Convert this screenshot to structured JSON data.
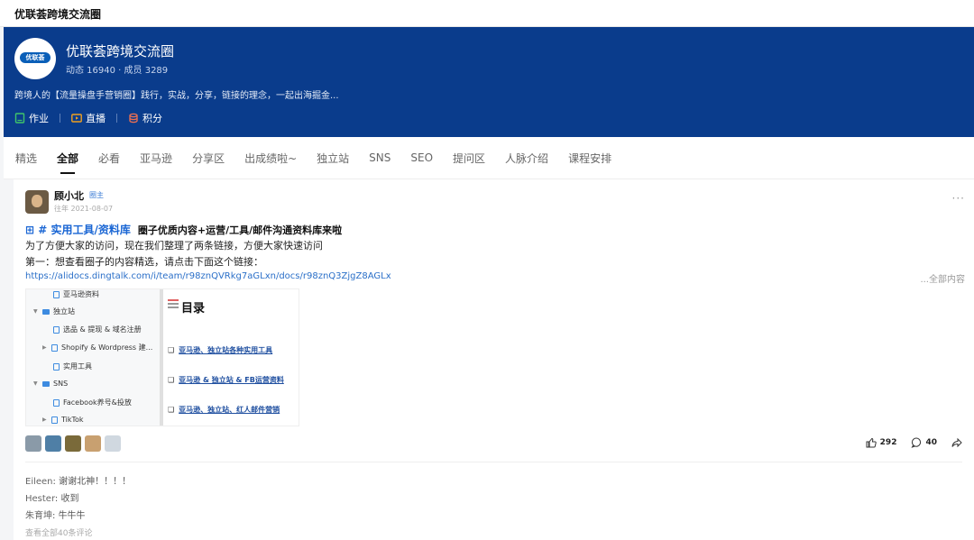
{
  "topbar": {
    "title": "优联荟跨境交流圈"
  },
  "hero": {
    "logo_text": "优联荟",
    "name": "优联荟跨境交流圈",
    "stats": "动态 16940 · 成员 3289",
    "description": "跨境人的【流量操盘手营销圈】践行，实战，分享，链接的理念，一起出海掘金...",
    "links": [
      {
        "label": "作业",
        "icon": "book-icon",
        "color": "#3fc46a"
      },
      {
        "label": "直播",
        "icon": "video-icon",
        "color": "#f0a020"
      },
      {
        "label": "积分",
        "icon": "coins-icon",
        "color": "#f07050"
      }
    ]
  },
  "tabs": [
    "精选",
    "全部",
    "必看",
    "亚马逊",
    "分享区",
    "出成绩啦~",
    "独立站",
    "SNS",
    "SEO",
    "提问区",
    "人脉介绍",
    "课程安排"
  ],
  "post": {
    "author": "顾小北",
    "badge": "圈主",
    "date": "往年 2021-08-07",
    "tag": "⊞ # 实用工具/资料库",
    "headline": "圈子优质内容+运营/工具/邮件沟通资料库来啦",
    "line1": "为了方便大家的访问，现在我们整理了两条链接，方便大家快速访问",
    "line2": "第一：想查看圈子的内容精选，请点击下面这个链接：",
    "url": "https://alidocs.dingtalk.com/i/team/r98znQVRkg7aGLxn/docs/r98znQ3ZjgZ8AGLx",
    "full_content": "...全部内容",
    "screenshot": {
      "tree": [
        {
          "label": "亚马逊资料",
          "type": "doc",
          "indent": 2
        },
        {
          "label": "独立站",
          "type": "folder",
          "indent": 1,
          "arrow": "▼"
        },
        {
          "label": "选品 & 提现 & 域名注册",
          "type": "doc",
          "indent": 2
        },
        {
          "label": "Shopify & Wordpress 建...",
          "type": "doc",
          "indent": 2,
          "arrow": "▶"
        },
        {
          "label": "实用工具",
          "type": "doc",
          "indent": 2
        },
        {
          "label": "SNS",
          "type": "folder",
          "indent": 1,
          "arrow": "▼"
        },
        {
          "label": "Facebook养号&投放",
          "type": "doc",
          "indent": 2
        },
        {
          "label": "TikTok",
          "type": "doc",
          "indent": 2,
          "arrow": "▶"
        }
      ],
      "toc_title": "目录",
      "toc_items": [
        "亚马逊、独立站各种实用工具",
        "亚马逊 & 独立站 & FB运营资料",
        "亚马逊、独立站、红人邮件营销"
      ]
    },
    "likes": "292",
    "comments_count": "40",
    "comments": [
      {
        "who": "Eileen",
        "text": "谢谢北神！！！！"
      },
      {
        "who": "Hester",
        "text": "收到"
      },
      {
        "who": "朱育坤",
        "text": "牛牛牛"
      }
    ],
    "all_comments": "查看全部40条评论"
  }
}
